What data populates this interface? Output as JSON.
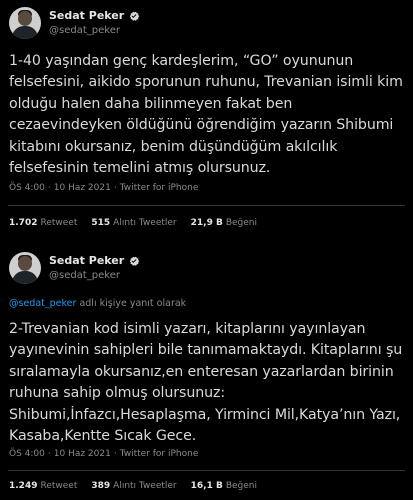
{
  "tweet1": {
    "author_name": "Sedat Peker",
    "author_handle": "@sedat_peker",
    "text": "1-40 yaşından genç kardeşlerim, “GO” oyununun\nfelsefesini, aikido sporunun ruhunu, Trevanian isimli kim\nolduğu halen daha bilinmeyen fakat ben\ncezaevindeyken öldüğünü öğrendiğim yazarın Shibumi\nkitabını okursanız, benim düşündüğüm akılcılık\nfelsefesinin temelini atmış olursunuz.",
    "time": "ÖS 4:00",
    "date": "10 Haz 2021",
    "source": "Twitter for iPhone",
    "sep": "·",
    "retweets": "1.702",
    "retweets_label": "Retweet",
    "quotes": "515",
    "quotes_label": "Alıntı Tweetler",
    "likes": "21,9 B",
    "likes_label": "Beğeni"
  },
  "tweet2": {
    "author_name": "Sedat Peker",
    "author_handle": "@sedat_peker",
    "reply_mention": "@sedat_peker",
    "reply_suffix": "adlı kişiye yanıt olarak",
    "text": "2-Trevanian kod isimli yazarı, kitaplarını yayınlayan\nyayınevinin sahipleri bile tanımamaktaydı. Kitaplarını şu\nsıralamayla okursanız,en enteresan yazarlardan birinin\nruhuna sahip olmuş olursunuz:\nShibumi,İnfazcı,Hesaplaşma, Yirminci Mil,Katya’nın Yazı,\nKasaba,Kentte Sıcak Gece.",
    "time": "ÖS 4:00",
    "date": "10 Haz 2021",
    "source": "Twitter for iPhone",
    "sep": "·",
    "retweets": "1.249",
    "retweets_label": "Retweet",
    "quotes": "389",
    "quotes_label": "Alıntı Tweetler",
    "likes": "16,1 B",
    "likes_label": "Beğeni"
  },
  "icons": {
    "verified": "verified-badge-icon",
    "avatar": "profile-photo"
  },
  "colors": {
    "background": "#000000",
    "verified": "#d9d9d9",
    "link": "#1d9bf0"
  }
}
